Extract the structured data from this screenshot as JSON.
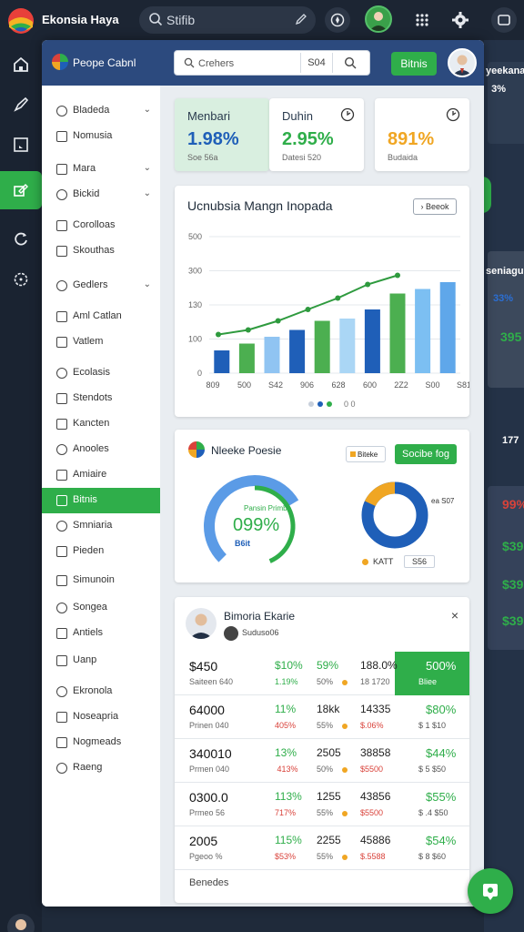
{
  "topbar": {
    "title": "Ekonsia Haya",
    "search": "Stifib"
  },
  "panel": {
    "title": "Peope Cabnl",
    "search_value": "Crehers",
    "search_count": "S04",
    "action": "Bitnis"
  },
  "menu": [
    {
      "label": "Bladeda",
      "chevron": true
    },
    {
      "label": "Nomusia",
      "chevron": false
    },
    {
      "label": "Mara",
      "chevron": true
    },
    {
      "label": "Bickid",
      "chevron": true
    },
    {
      "label": "Corolloas",
      "chevron": false
    },
    {
      "label": "Skouthas",
      "chevron": false
    },
    {
      "label": "Gedlers",
      "chevron": true
    },
    {
      "label": "Aml Catlan",
      "chevron": false
    },
    {
      "label": "Vatlem",
      "chevron": false
    },
    {
      "label": "Ecolasis",
      "chevron": false
    },
    {
      "label": "Stendots",
      "chevron": false
    },
    {
      "label": "Kancten",
      "chevron": false
    },
    {
      "label": "Anooles",
      "chevron": false
    },
    {
      "label": "Amiaire",
      "chevron": false
    },
    {
      "label": "Bitnis",
      "chevron": false,
      "active": true
    },
    {
      "label": "Smniaria",
      "chevron": false
    },
    {
      "label": "Pieden",
      "chevron": false
    },
    {
      "label": "Simunoin",
      "chevron": false
    },
    {
      "label": "Songea",
      "chevron": false
    },
    {
      "label": "Antiels",
      "chevron": false
    },
    {
      "label": "Uanp",
      "chevron": false
    },
    {
      "label": "Ekronola",
      "chevron": false
    },
    {
      "label": "Noseapria",
      "chevron": false
    },
    {
      "label": "Nogmeads",
      "chevron": false
    },
    {
      "label": "Raeng",
      "chevron": false
    }
  ],
  "kpis": [
    {
      "label": "Menbari",
      "value": "1.98%",
      "sub": "Soe 56a",
      "color": "#1f5fb8"
    },
    {
      "label": "Duhin",
      "value": "2.95%",
      "sub": "Datesi 520",
      "color": "#2fae4a"
    },
    {
      "label": "",
      "value": "891%",
      "sub": "Budaida",
      "color": "#f0a623"
    }
  ],
  "chart": {
    "title": "Ucnubsia Mangn Inopada",
    "button": "Beeok",
    "legend": "0 0",
    "ylabels": [
      "500",
      "300",
      "130",
      "100",
      "0"
    ],
    "xlabels": [
      "809",
      "500",
      "S42",
      "906",
      "628",
      "600",
      "2Z2",
      "S00",
      "S81"
    ]
  },
  "chart_data": {
    "type": "bar",
    "title": "Ucnubsia Mangn Inopada",
    "categories": [
      "809",
      "500",
      "S42",
      "906",
      "628",
      "600",
      "2Z2",
      "S00",
      "S81"
    ],
    "ylim": [
      0,
      600
    ],
    "series": [
      {
        "values": [
          100,
          130,
          160,
          190,
          230,
          240,
          280,
          350,
          370,
          400,
          280
        ]
      }
    ],
    "bars": [
      100,
      130,
      160,
      190,
      230,
      240,
      280,
      350,
      370,
      400,
      280
    ],
    "line": [
      170,
      190,
      230,
      280,
      330,
      390,
      430
    ]
  },
  "ring": {
    "title": "Nleeke Poesie",
    "small_button": "Biteke",
    "button": "Socibe fog",
    "center_label": "Pansin Primba",
    "center_value": "099%",
    "center_sub": "B6it",
    "pie_label": "ea S07",
    "legend_a": "KATT",
    "legend_b": "S56"
  },
  "ring_data": {
    "gauge_blue": 0.72,
    "gauge_green": 0.58,
    "pie_orange": 0.18
  },
  "table": {
    "title": "Bimoria Ekarie",
    "subtitle": "Suduso06",
    "footer": "Benedes",
    "rows": [
      {
        "main": "$450",
        "sub": "Saiteen 640",
        "c1": "$10%",
        "c1s": "1.19%",
        "c2": "59%",
        "c2s": "50%",
        "c3": "188.0%",
        "c3s": "18 1720",
        "c4": "500%",
        "c4s": "Bliee",
        "hl": true
      },
      {
        "main": "64000",
        "sub": "Prinen 040",
        "c1": "11%",
        "c1s": "405%",
        "c2": "18kk",
        "c2s": "55%",
        "c3": "14335",
        "c3s": "$.06%",
        "c4": "$80%",
        "c4s": "$ 1 $10"
      },
      {
        "main": "340010",
        "sub": "Prmen 040",
        "c1": "13%",
        "c1s": " 413%",
        "c2": "2505",
        "c2s": "50%",
        "c3": "38858",
        "c3s": "$5500",
        "c4": "$44%",
        "c4s": "$ 5 $50"
      },
      {
        "main": "0300.0",
        "sub": "Prmeo 56",
        "c1": "113%",
        "c1s": "717%",
        "c2": "1255",
        "c2s": "55%",
        "c3": "43856",
        "c3s": "$5500",
        "c4": "$55%",
        "c4s": "$ .4 $50"
      },
      {
        "main": "2005",
        "sub": "Pgeoo %",
        "c1": "115%",
        "c1s": "$53%",
        "c2": "2255",
        "c2s": "55%",
        "c3": "45886",
        "c3s": "$.5588",
        "c4": "$54%",
        "c4s": "$ 8 $60"
      }
    ]
  },
  "background": {
    "t1": "yeekana",
    "t2": "  3%",
    "t3": "seniague",
    "t4": "33%",
    "t5": "395",
    "t6": "177",
    "t7": "99%",
    "t8": "$39",
    "t9": "$39",
    "t10": "$39"
  },
  "colors": {
    "accent": "#2fae4a",
    "brand": "#2c4a7e",
    "blue": "#1f5fb8",
    "orange": "#f0a623",
    "red": "#d9423a"
  }
}
